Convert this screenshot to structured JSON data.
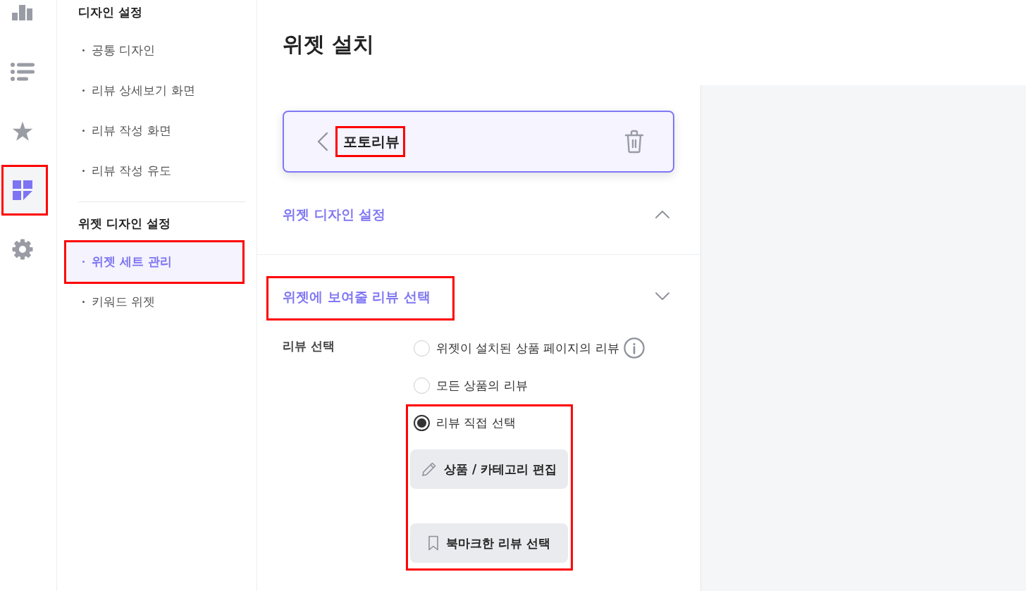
{
  "rail": {
    "items": [
      {
        "kind": "chart",
        "selected": false,
        "highlighted": false
      },
      {
        "kind": "list",
        "selected": false,
        "highlighted": false
      },
      {
        "kind": "star",
        "selected": false,
        "highlighted": false
      },
      {
        "kind": "widgets",
        "selected": true,
        "highlighted": true
      },
      {
        "kind": "settings",
        "selected": false,
        "highlighted": false
      }
    ]
  },
  "nav": {
    "groups": [
      {
        "title": "디자인 설정",
        "items": [
          {
            "label": "공통 디자인",
            "selected": false,
            "highlighted": false
          },
          {
            "label": "리뷰 상세보기 화면",
            "selected": false,
            "highlighted": false
          },
          {
            "label": "리뷰 작성 화면",
            "selected": false,
            "highlighted": false
          },
          {
            "label": "리뷰 작성 유도",
            "selected": false,
            "highlighted": false
          }
        ]
      },
      {
        "title": "위젯 디자인 설정",
        "items": [
          {
            "label": "위젯 세트 관리",
            "selected": true,
            "highlighted": true
          },
          {
            "label": "키워드 위젯",
            "selected": false,
            "highlighted": false
          }
        ]
      }
    ]
  },
  "page_title": "위젯 설치",
  "widget_card": {
    "title": "포토리뷰",
    "highlighted": true
  },
  "sections": [
    {
      "title": "위젯 디자인 설정",
      "expanded": false,
      "highlighted": false
    },
    {
      "title": "위젯에 보여줄 리뷰 선택",
      "expanded": true,
      "highlighted": true,
      "field": {
        "label": "리뷰 선택",
        "options": [
          {
            "label": "위젯이 설치된 상품 페이지의 리뷰",
            "selected": false,
            "highlighted": false,
            "info": true
          },
          {
            "label": "모든 상품의 리뷰",
            "selected": false,
            "highlighted": false,
            "info": false
          },
          {
            "label": "리뷰 직접 선택",
            "selected": true,
            "highlighted": true,
            "info": false,
            "buttons": [
              {
                "label": "상품 / 카테고리 편집",
                "kind": "edit"
              },
              {
                "label": "북마크한 리뷰 선택",
                "kind": "bookmark"
              }
            ]
          }
        ]
      }
    }
  ]
}
